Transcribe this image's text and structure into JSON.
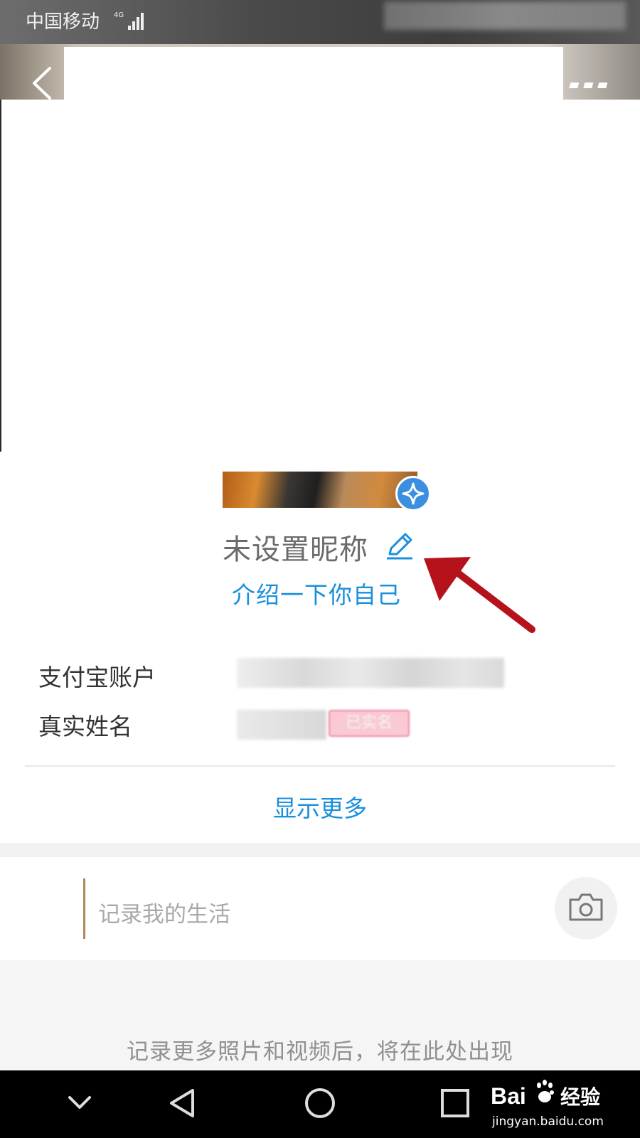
{
  "status_bar": {
    "carrier": "中国移动",
    "network": "4G"
  },
  "header": {
    "back_icon": "chevron-left-icon",
    "more_icon": "more-dots-icon"
  },
  "profile": {
    "nickname": "未设置昵称",
    "edit_icon": "pencil-edit-icon",
    "intro_link": "介绍一下你自己",
    "badge_icon": "sparkle-badge-icon"
  },
  "info": {
    "account_label": "支付宝账户",
    "real_name_label": "真实姓名",
    "verified_badge": "已实名"
  },
  "show_more": "显示更多",
  "post": {
    "placeholder": "记录我的生活",
    "camera_icon": "camera-icon"
  },
  "footer_note": "记录更多照片和视频后，将在此处出现",
  "nav": {
    "icons": [
      "chevron-down-icon",
      "back-triangle-icon",
      "home-circle-icon",
      "recents-square-icon"
    ]
  },
  "watermark": {
    "brand": "Bai",
    "brand_suffix": "经验",
    "url": "jingyan.baidu.com"
  },
  "colors": {
    "accent_blue": "#1a8fdc",
    "annotation_red": "#b5121b",
    "post_accent": "#b08a52"
  }
}
